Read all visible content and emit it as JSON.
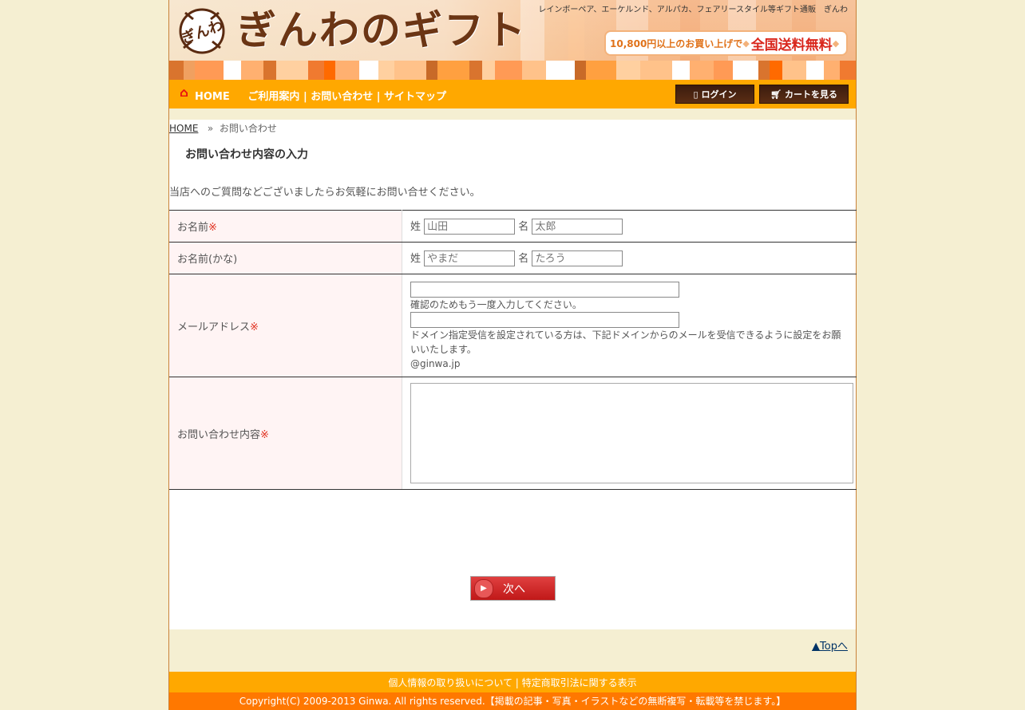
{
  "header": {
    "logo_text": "ぎんわのギフト",
    "logo_badge": "ぎんわ",
    "tagline": "レインボーペア、エーケルンド、アルパカ、フェアリースタイル等ギフト通販　ぎんわ",
    "shipping_small": "10,800円以上のお買い上げで",
    "shipping_big": "全国送料無料"
  },
  "nav": {
    "home": "HOME",
    "guide": "ご利用案内",
    "contact": "お問い合わせ",
    "sitemap": "サイトマップ",
    "sep": "|",
    "login": "ログイン",
    "cart": "カートを見る"
  },
  "breadcrumb": {
    "home": "HOME",
    "sep": "»",
    "current": "お問い合わせ"
  },
  "page_title": "お問い合わせ内容の入力",
  "intro": "当店へのご質問などございましたらお気軽にお問い合せください。",
  "form": {
    "required_mark": "※",
    "name": {
      "label": "お名前",
      "last_label": "姓",
      "first_label": "名",
      "last_placeholder": "山田",
      "first_placeholder": "太郎"
    },
    "kana": {
      "label": "お名前(かな)",
      "last_label": "姓",
      "first_label": "名",
      "last_placeholder": "やまだ",
      "first_placeholder": "たろう"
    },
    "email": {
      "label": "メールアドレス",
      "confirm_note": "確認のためもう一度入力してください。",
      "domain_note": "ドメイン指定受信を設定されている方は、下記ドメインからのメールを受信できるように設定をお願いいたします。",
      "domain": "@ginwa.jp"
    },
    "inquiry": {
      "label": "お問い合わせ内容"
    }
  },
  "next_button": "次へ",
  "top_link": "▲Topへ",
  "footer": {
    "privacy": "個人情報の取り扱いについて",
    "sep": "|",
    "law": "特定商取引法に関する表示",
    "copyright": "Copyright(C) 2009-2013 Ginwa. All rights reserved.【掲載の記事・写真・イラストなどの無断複写・転載等を禁じます。】"
  },
  "colors": {
    "nav": "#ffa800",
    "footer_bottom": "#ff7800",
    "accent_red": "#d9261c",
    "brown": "#6b3514"
  }
}
